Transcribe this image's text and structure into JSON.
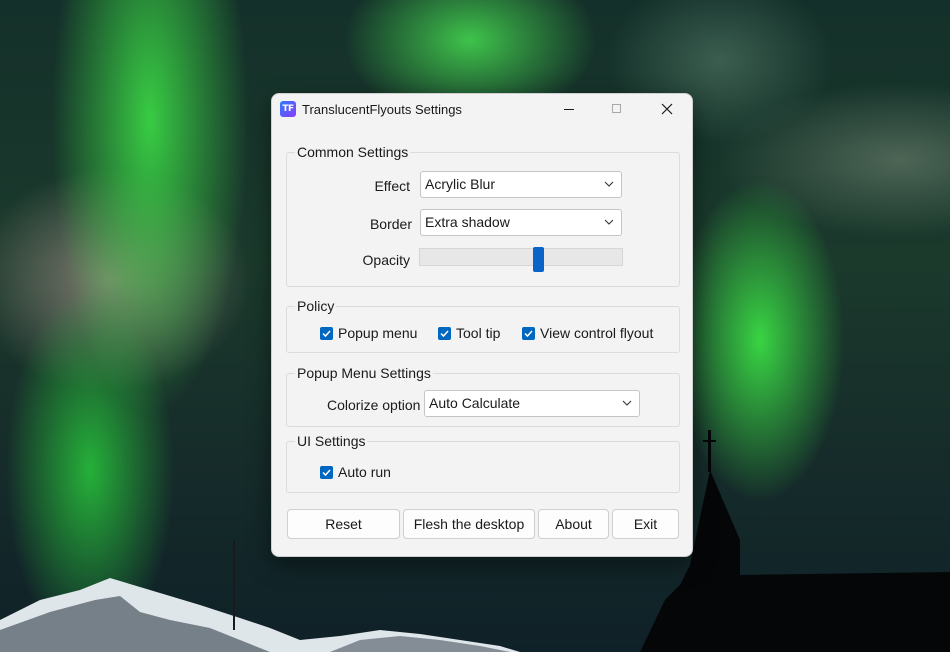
{
  "window": {
    "title": "TranslucentFlyouts Settings",
    "icon_text": "TF"
  },
  "common_settings": {
    "label": "Common Settings",
    "effect_label": "Effect",
    "effect_value": "Acrylic Blur",
    "border_label": "Border",
    "border_value": "Extra shadow",
    "opacity_label": "Opacity",
    "opacity_fraction": 0.59
  },
  "policy": {
    "label": "Policy",
    "items": [
      {
        "label": "Popup menu",
        "checked": true
      },
      {
        "label": "Tool tip",
        "checked": true
      },
      {
        "label": "View control flyout",
        "checked": true
      }
    ]
  },
  "popup_menu_settings": {
    "label": "Popup Menu Settings",
    "colorize_label": "Colorize option",
    "colorize_value": "Auto Calculate"
  },
  "ui_settings": {
    "label": "UI Settings",
    "auto_run_label": "Auto run",
    "auto_run_checked": true
  },
  "buttons": {
    "reset": "Reset",
    "flesh": "Flesh the desktop",
    "about": "About",
    "exit": "Exit"
  },
  "colors": {
    "accent": "#0067c0",
    "slider_thumb": "#0a64c8",
    "window_bg": "#f3f3f3"
  }
}
